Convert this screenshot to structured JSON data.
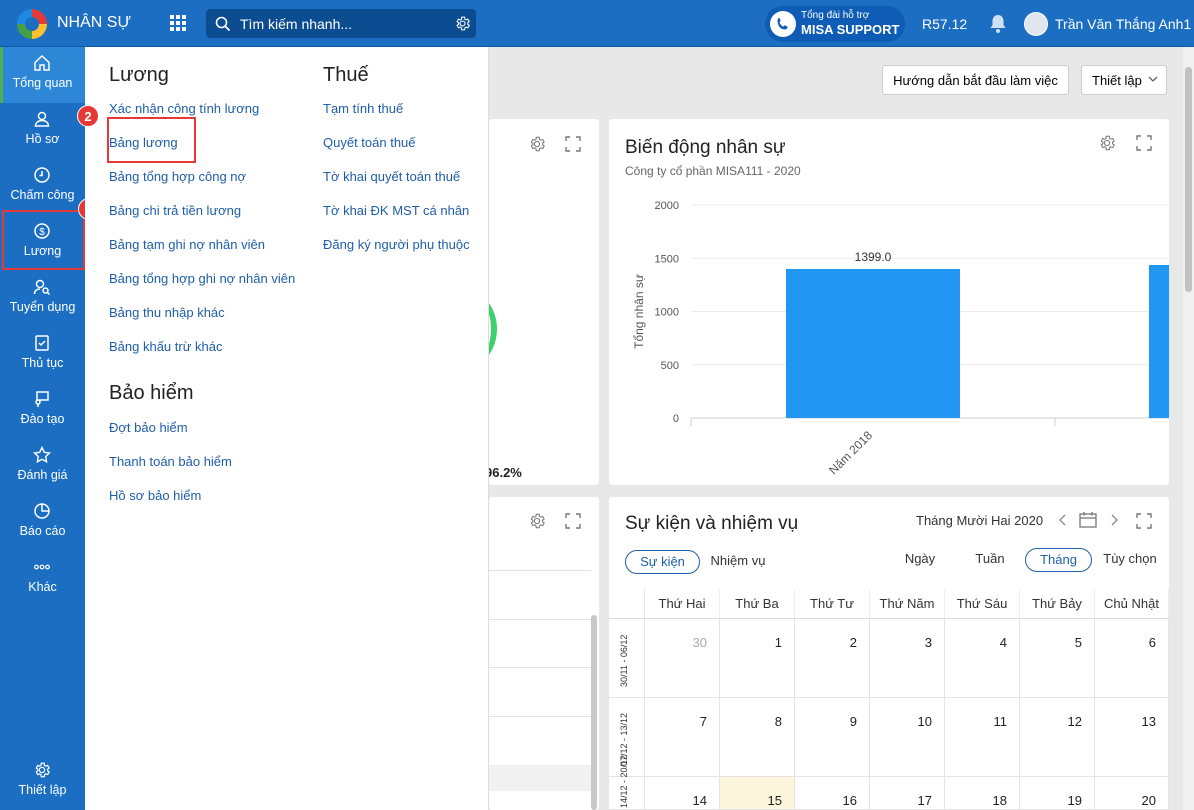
{
  "app": {
    "name": "NHÂN SỰ"
  },
  "search": {
    "placeholder": "Tìm kiếm nhanh..."
  },
  "support": {
    "line1": "Tổng đài hỗ trợ",
    "line2": "MISA SUPPORT"
  },
  "version": "R57.12",
  "user": {
    "name": "Trần Văn Thắng Anh1"
  },
  "sidebar": {
    "items": [
      {
        "label": "Tổng quan",
        "icon": "home-icon"
      },
      {
        "label": "Hồ sơ",
        "icon": "user-icon"
      },
      {
        "label": "Chấm công",
        "icon": "clock-icon"
      },
      {
        "label": "Lương",
        "icon": "dollar-icon"
      },
      {
        "label": "Tuyển dụng",
        "icon": "recruit-icon"
      },
      {
        "label": "Thủ tục",
        "icon": "checklist-icon"
      },
      {
        "label": "Đào tạo",
        "icon": "training-icon"
      },
      {
        "label": "Đánh giá",
        "icon": "star-icon"
      },
      {
        "label": "Báo cáo",
        "icon": "pie-icon"
      },
      {
        "label": "Khác",
        "icon": "more-icon"
      }
    ],
    "settings_label": "Thiết lập"
  },
  "toolbar": {
    "guide_label": "Hướng dẫn bắt đầu làm việc",
    "setup_label": "Thiết lập"
  },
  "menu": {
    "salary": {
      "title": "Lương",
      "items": [
        "Xác nhận công tính lương",
        "Bảng lương",
        "Bảng tổng hợp công nợ",
        "Bảng chi trả tiền lương",
        "Bảng tạm ghi nợ nhân viên",
        "Bảng tổng hợp ghi nợ nhân viên",
        "Bảng thu nhập khác",
        "Bảng khấu trừ khác"
      ]
    },
    "tax": {
      "title": "Thuế",
      "items": [
        "Tạm tính thuế",
        "Quyết toán thuế",
        "Tờ khai quyết toán thuế",
        "Tờ khai ĐK MST cá nhân",
        "Đăng ký người phụ thuộc"
      ]
    },
    "insurance": {
      "title": "Bảo hiểm",
      "items": [
        "Đợt bảo hiểm",
        "Thanh toán bảo hiểm",
        "Hồ sơ bảo hiểm"
      ]
    }
  },
  "annotations": {
    "badge1": "1",
    "badge2": "2"
  },
  "left_card": {
    "percent": "96.2%"
  },
  "staff_chart": {
    "title": "Biến động nhân sự",
    "subtitle": "Công ty cổ phần MISA111 - 2020",
    "chart_data": {
      "type": "bar",
      "ylabel": "Tổng nhân sự",
      "yticks": [
        0,
        500,
        1000,
        1500,
        2000
      ],
      "ylim": [
        0,
        2000
      ],
      "categories": [
        "Năm 2018"
      ],
      "values": [
        1399.0
      ],
      "data_labels": [
        "1399.0"
      ]
    }
  },
  "events": {
    "title": "Sự kiện và nhiệm vụ",
    "month": "Tháng Mười Hai 2020",
    "tabs": [
      "Sự kiện",
      "Nhiệm vụ"
    ],
    "views": [
      "Ngày",
      "Tuần",
      "Tháng",
      "Tùy chọn"
    ],
    "weekdays": [
      "Thứ Hai",
      "Thứ Ba",
      "Thứ Tư",
      "Thứ Năm",
      "Thứ Sáu",
      "Thứ Bảy",
      "Chủ Nhật"
    ],
    "weeks": [
      {
        "label": "30/11 - 06/12",
        "days": [
          "30",
          "1",
          "2",
          "3",
          "4",
          "5",
          "6"
        ]
      },
      {
        "label": "07/12 - 13/12",
        "days": [
          "7",
          "8",
          "9",
          "10",
          "11",
          "12",
          "13"
        ]
      },
      {
        "label": "14/12 - 20/12",
        "days": [
          "14",
          "15",
          "16",
          "17",
          "18",
          "19",
          "20"
        ]
      }
    ]
  }
}
